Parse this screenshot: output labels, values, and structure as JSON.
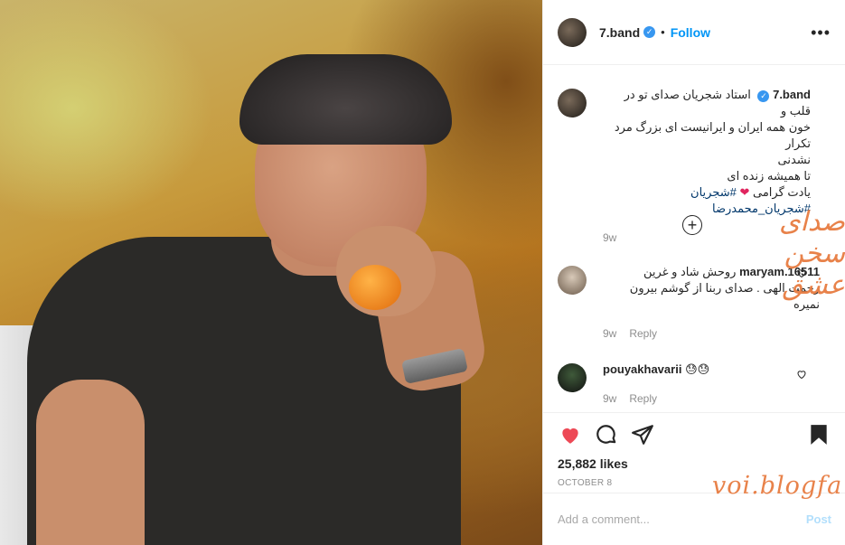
{
  "post": {
    "username": "7.band",
    "follow_label": "Follow",
    "more_label": "•••",
    "caption_text_line1": "استاد شجریان صدای تو در قلب و",
    "caption_text_line2": "خون همه ایران و ایرانیست ای بزرگ مرد تکرار",
    "caption_text_line3": "نشدنی",
    "caption_text_line4": "تا همیشه زنده ای",
    "caption_text_line5": "یادت گرامی",
    "caption_hashtags": "#شجریان #شجریان_محمدرضا",
    "caption_time": "9w",
    "likes": "25,882 likes",
    "date": "OCTOBER 8"
  },
  "comments": [
    {
      "username": "maryam.16511",
      "text_line1": "روحش شاد و غرین",
      "text_line2": "رحمت الهی . صدای ربنا از گوشم بیرون",
      "text_line3": "نمیره",
      "time": "9w",
      "reply_label": "Reply"
    },
    {
      "username": "pouyakhavarii",
      "text": "😓😓",
      "time": "9w",
      "reply_label": "Reply"
    }
  ],
  "overlay": {
    "calligraphy": "صدای سخن عشق",
    "plus": "+",
    "watermark": "voi.blogfa"
  },
  "composer": {
    "placeholder": "Add a comment...",
    "post_label": "Post"
  },
  "icons": {
    "like": "heart-icon",
    "comment": "comment-icon",
    "share": "share-icon",
    "save": "bookmark-icon"
  },
  "colors": {
    "link_blue": "#0095f6",
    "like_red": "#ed4956",
    "watermark_orange": "#e8824a"
  }
}
